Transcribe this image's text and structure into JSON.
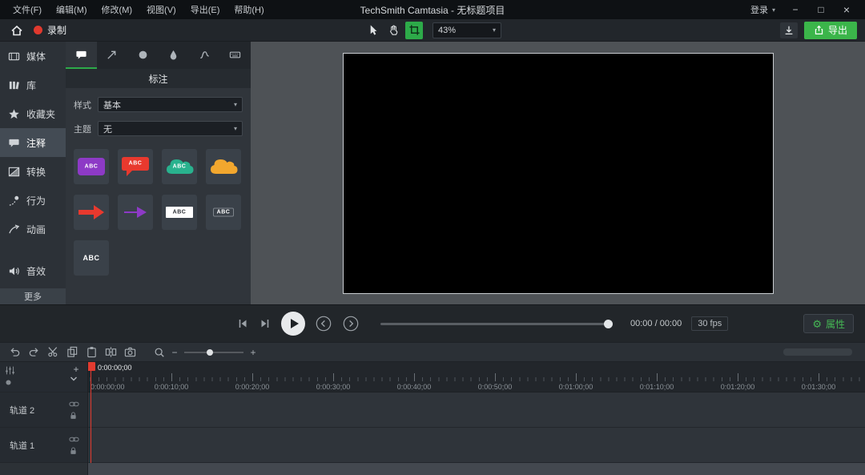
{
  "colors": {
    "accent_green": "#3bb54a",
    "record_red": "#e0392e",
    "playhead_red": "#e23b30"
  },
  "icons": {
    "caret_down": "▾",
    "minimize": "−",
    "maximize": "□",
    "close": "×",
    "gear": "⚙",
    "plus": "+",
    "minus": "−"
  },
  "menubar": {
    "menus": [
      {
        "label": "文件(F)"
      },
      {
        "label": "编辑(M)"
      },
      {
        "label": "修改(M)"
      },
      {
        "label": "视图(V)"
      },
      {
        "label": "导出(E)"
      },
      {
        "label": "帮助(H)"
      }
    ],
    "title": "TechSmith Camtasia - 无标题项目",
    "login_label": "登录"
  },
  "toolbar": {
    "record_label": "录制",
    "zoom_value": "43%",
    "export_label": "导出"
  },
  "sidebar": {
    "items": [
      {
        "label": "媒体"
      },
      {
        "label": "库"
      },
      {
        "label": "收藏夹"
      },
      {
        "label": "注释"
      },
      {
        "label": "转换"
      },
      {
        "label": "行为"
      },
      {
        "label": "动画"
      },
      {
        "label": "音效"
      }
    ],
    "more_label": "更多"
  },
  "panel": {
    "title": "标注",
    "style_label": "样式",
    "style_value": "基本",
    "theme_label": "主题",
    "theme_value": "无",
    "tiles": [
      {
        "name": "rounded-rect-callout",
        "color": "#8d3ac6",
        "label": "ABC"
      },
      {
        "name": "speech-bubble-callout",
        "color": "#e8392e",
        "label": "ABC"
      },
      {
        "name": "cloud-callout",
        "color": "#29b28e",
        "label": "ABC"
      },
      {
        "name": "cloud-callout",
        "color": "#f2a72e",
        "label": ""
      },
      {
        "name": "arrow-callout",
        "color": "#e8392e",
        "label": ""
      },
      {
        "name": "arrow-callout",
        "color": "#8d3ac6",
        "label": ""
      },
      {
        "name": "text-box-callout",
        "color": "#ffffff",
        "label": "ABC"
      },
      {
        "name": "keystroke-callout",
        "color": "",
        "label": "ABC"
      },
      {
        "name": "text-callout",
        "color": "",
        "label": "ABC"
      }
    ]
  },
  "playback": {
    "time_display": "00:00 / 00:00",
    "fps": "30 fps",
    "properties_label": "属性"
  },
  "timeline": {
    "current_time": "0:00:00;00",
    "ruler_labels": [
      "0:00:00;00",
      "0:00:10;00",
      "0:00:20;00",
      "0:00:30;00",
      "0:00:40;00",
      "0:00:50;00",
      "0:01:00;00",
      "0:01:10;00",
      "0:01:20;00",
      "0:01:30;00"
    ],
    "tracks": [
      {
        "name": "轨道 2"
      },
      {
        "name": "轨道 1"
      }
    ]
  }
}
